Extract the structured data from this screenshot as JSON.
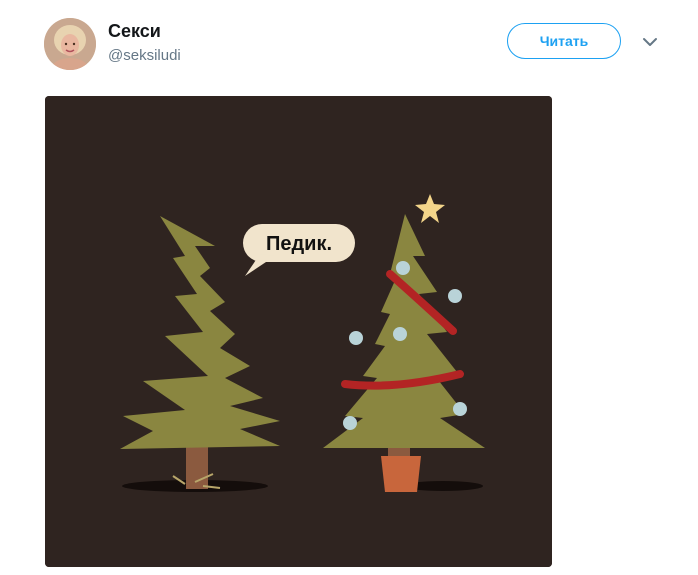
{
  "author": {
    "display_name": "Секси",
    "handle": "@seksiludi"
  },
  "actions": {
    "follow_label": "Читать",
    "more_icon": "chevron-down-icon"
  },
  "media": {
    "speech_bubble_text": "Педик.",
    "background_color": "#2f2420",
    "tree_color": "#8a8640",
    "garland_color": "#b32424",
    "ornament_color": "#b9d3d8",
    "star_color": "#f3d58a",
    "pot_color": "#c8663c"
  }
}
